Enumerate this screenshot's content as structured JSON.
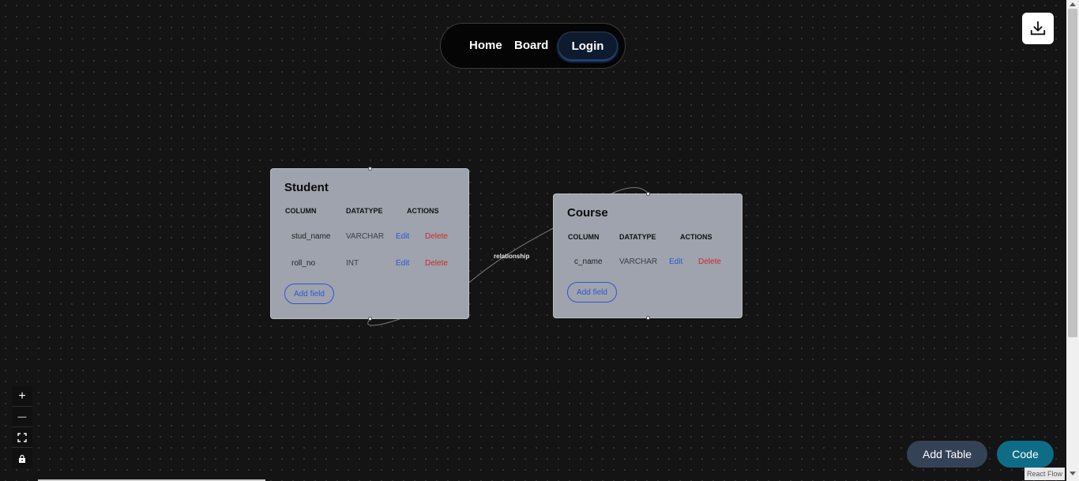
{
  "nav": {
    "home": "Home",
    "board": "Board",
    "login": "Login"
  },
  "edge": {
    "label": "relationship"
  },
  "tables": [
    {
      "title": "Student",
      "headers": [
        "COLUMN",
        "DATATYPE",
        "ACTIONS"
      ],
      "rows": [
        {
          "column": "stud_name",
          "datatype": "VARCHAR",
          "edit": "Edit",
          "delete": "Delete"
        },
        {
          "column": "roll_no",
          "datatype": "INT",
          "edit": "Edit",
          "delete": "Delete"
        }
      ],
      "add_field": "Add field"
    },
    {
      "title": "Course",
      "headers": [
        "COLUMN",
        "DATATYPE",
        "ACTIONS"
      ],
      "rows": [
        {
          "column": "c_name",
          "datatype": "VARCHAR",
          "edit": "Edit",
          "delete": "Delete"
        }
      ],
      "add_field": "Add field"
    }
  ],
  "controls": {
    "zoom_in": "+",
    "zoom_out": "—"
  },
  "buttons": {
    "add_table": "Add Table",
    "code": "Code"
  },
  "attribution": "React Flow",
  "colors": {
    "background": "#141414",
    "node": "#9ea3ae",
    "edit_link": "#2f55d4",
    "delete_link": "#cc2a2a",
    "add_table_btn": "#344256",
    "code_btn": "#0f6c86"
  },
  "icons": [
    "download-icon",
    "zoom-in-icon",
    "zoom-out-icon",
    "fit-view-icon",
    "lock-icon"
  ]
}
